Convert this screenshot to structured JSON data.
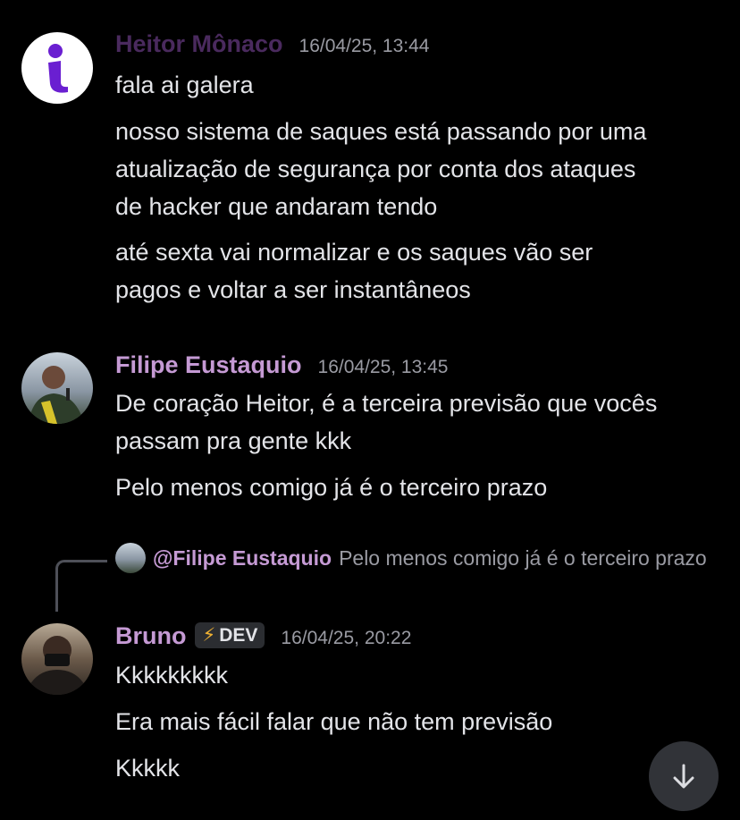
{
  "colors": {
    "background": "#000000",
    "heitor_name": "#4a2a5e",
    "filipe_name": "#c59ad4",
    "bruno_name": "#c59ad4",
    "timestamp": "#9a9ba3",
    "text": "#e3e4e8",
    "dev_bolt": "#f0b232"
  },
  "messages": [
    {
      "author": "Heitor Mônaco",
      "timestamp": "16/04/25, 13:44",
      "avatar_icon": "i-logo-icon",
      "lines": [
        "fala ai galera",
        "nosso sistema de saques está passando por uma",
        "atualização de segurança por conta dos ataques",
        "de hacker que andaram tendo",
        "até sexta vai normalizar e os saques vão ser",
        "pagos e voltar a ser instantâneos"
      ]
    },
    {
      "author": "Filipe Eustaquio",
      "timestamp": "16/04/25, 13:45",
      "avatar_icon": "user-photo-icon",
      "lines": [
        "De coração Heitor, é a terceira previsão que vocês",
        "passam pra gente kkk",
        "Pelo menos comigo já é o terceiro prazo"
      ]
    },
    {
      "author": "Bruno",
      "badge": "DEV",
      "badge_icon": "lightning-icon",
      "timestamp": "16/04/25, 20:22",
      "avatar_icon": "user-photo-icon",
      "reply": {
        "user": "@Filipe Eustaquio",
        "text": "Pelo menos comigo já é o terceiro prazo"
      },
      "lines": [
        "Kkkkkkkkk",
        "Era mais fácil falar que não tem previsão",
        "Kkkkk"
      ]
    }
  ],
  "scroll_button_icon": "arrow-down-icon"
}
